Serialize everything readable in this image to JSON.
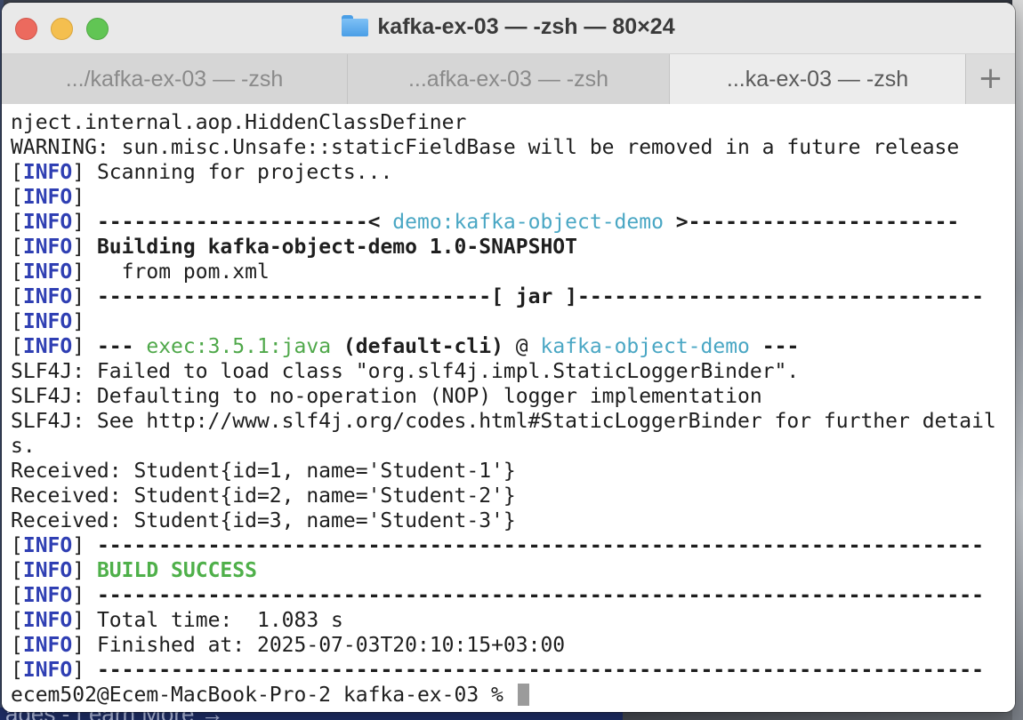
{
  "window": {
    "title": "kafka-ex-03 — -zsh — 80×24"
  },
  "tabs": [
    {
      "label": ".../kafka-ex-03 — -zsh"
    },
    {
      "label": "...afka-ex-03 — -zsh"
    },
    {
      "label": "...ka-ex-03 — -zsh"
    }
  ],
  "tab_add_label": "+",
  "background": {
    "bottom_text": "ages - Learn More →"
  },
  "terminal": {
    "lines": {
      "l1": "nject.internal.aop.HiddenClassDefiner",
      "l2": "WARNING: sun.misc.Unsafe::staticFieldBase will be removed in a future release",
      "info_open": "[",
      "info_word": "INFO",
      "info_close": "]",
      "l3": " Scanning for projects...",
      "l5_left": " ----------------------< ",
      "l5_mid": "demo:kafka-object-demo",
      "l5_right": " >----------------------",
      "l6": " Building kafka-object-demo 1.0-SNAPSHOT",
      "l7": "   from pom.xml",
      "l8": " --------------------------------[ jar ]---------------------------------",
      "l10_a": " --- ",
      "l10_b": "exec:3.5.1:java",
      "l10_c": " (default-cli)",
      "l10_d": " @ ",
      "l10_e": "kafka-object-demo",
      "l10_f": " ---",
      "l11": "SLF4J: Failed to load class \"org.slf4j.impl.StaticLoggerBinder\".",
      "l12": "SLF4J: Defaulting to no-operation (NOP) logger implementation",
      "l13": "SLF4J: See http://www.slf4j.org/codes.html#StaticLoggerBinder for further detail",
      "l14": "s.",
      "l15": "Received: Student{id=1, name='Student-1'}",
      "l16": "Received: Student{id=2, name='Student-2'}",
      "l17": "Received: Student{id=3, name='Student-3'}",
      "rule": " ------------------------------------------------------------------------",
      "l19": " BUILD SUCCESS",
      "l21": " Total time:  1.083 s",
      "l22": " Finished at: 2025-07-03T20:10:15+03:00",
      "prompt": "ecem502@Ecem-MacBook-Pro-2 kafka-ex-03 % "
    }
  },
  "colors": {
    "info_tag": "#2f3fb3",
    "cyan": "#4aa7c4",
    "green": "#4fa84a",
    "success": "#4fb04a"
  }
}
